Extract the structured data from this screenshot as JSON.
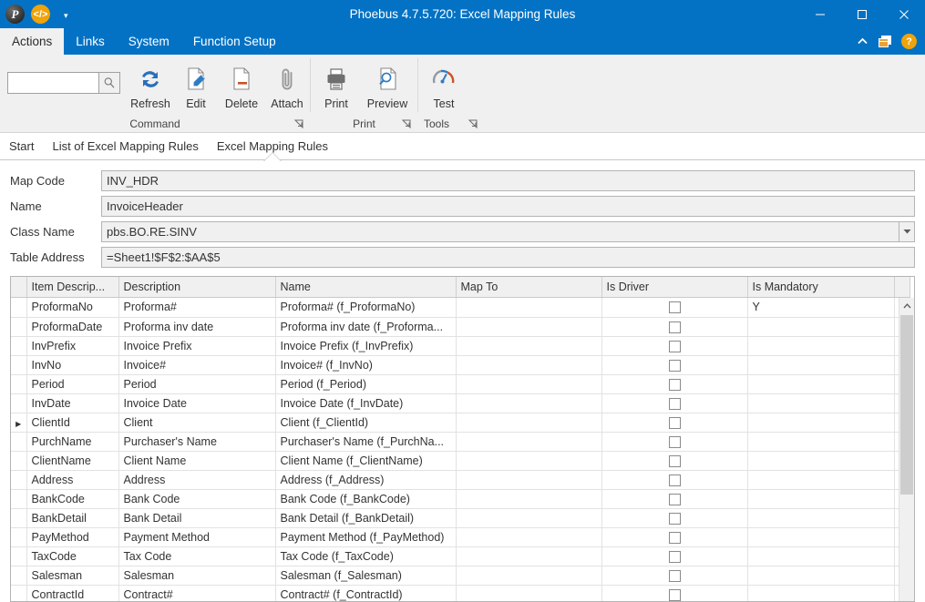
{
  "window": {
    "title": "Phoebus 4.7.5.720: Excel Mapping Rules",
    "quick_access": [
      {
        "name": "phoebus-logo",
        "glyph": "P"
      },
      {
        "name": "code-icon",
        "glyph": "</>"
      }
    ],
    "qat_dropdown_glyph": "▾",
    "controls": {
      "minimize": "─",
      "maximize": "☐",
      "close": "✕"
    },
    "accent_color": "#0472c4",
    "help_glyph": "?",
    "collapse_glyph": "⌃"
  },
  "menu": {
    "tabs": [
      {
        "label": "Actions",
        "active": true
      },
      {
        "label": "Links",
        "active": false
      },
      {
        "label": "System",
        "active": false
      },
      {
        "label": "Function Setup",
        "active": false
      }
    ]
  },
  "ribbon": {
    "search": {
      "value": "",
      "placeholder": ""
    },
    "groups": [
      {
        "label": "Command",
        "has_launcher": true,
        "buttons": [
          {
            "label": "Refresh",
            "icon": "refresh-icon"
          },
          {
            "label": "Edit",
            "icon": "edit-document-icon"
          },
          {
            "label": "Delete",
            "icon": "delete-document-icon"
          },
          {
            "label": "Attach",
            "icon": "paperclip-icon"
          }
        ]
      },
      {
        "label": "Print",
        "has_launcher": true,
        "buttons": [
          {
            "label": "Print",
            "icon": "printer-icon"
          },
          {
            "label": "Preview",
            "icon": "print-preview-icon"
          }
        ]
      },
      {
        "label": "Tools",
        "has_launcher": true,
        "buttons": [
          {
            "label": "Test",
            "icon": "gauge-test-icon"
          }
        ]
      }
    ]
  },
  "form_tabs": [
    {
      "label": "Start",
      "active": false
    },
    {
      "label": "List of Excel Mapping Rules",
      "active": false
    },
    {
      "label": "Excel Mapping Rules",
      "active": true
    }
  ],
  "form": {
    "fields": [
      {
        "label": "Map Code",
        "value": "INV_HDR",
        "type": "text"
      },
      {
        "label": "Name",
        "value": "InvoiceHeader",
        "type": "text"
      },
      {
        "label": "Class Name",
        "value": "pbs.BO.RE.SINV",
        "type": "combo"
      },
      {
        "label": "Table Address",
        "value": "=Sheet1!$F$2:$AA$5",
        "type": "text"
      }
    ]
  },
  "grid": {
    "columns": [
      "Item Descrip...",
      "Description",
      "Name",
      "Map To",
      "Is Driver",
      "Is Mandatory"
    ],
    "selected_row_index": 6,
    "rows": [
      {
        "item": "ProformaNo",
        "description": "Proforma#",
        "name": "Proforma# (f_ProformaNo)",
        "map_to": "",
        "is_driver": false,
        "is_mandatory": "Y"
      },
      {
        "item": "ProformaDate",
        "description": "Proforma inv date",
        "name": "Proforma inv date (f_Proforma...",
        "map_to": "",
        "is_driver": false,
        "is_mandatory": ""
      },
      {
        "item": "InvPrefix",
        "description": "Invoice Prefix",
        "name": "Invoice Prefix (f_InvPrefix)",
        "map_to": "",
        "is_driver": false,
        "is_mandatory": ""
      },
      {
        "item": "InvNo",
        "description": "Invoice#",
        "name": "Invoice# (f_InvNo)",
        "map_to": "",
        "is_driver": false,
        "is_mandatory": ""
      },
      {
        "item": "Period",
        "description": "Period",
        "name": "Period (f_Period)",
        "map_to": "",
        "is_driver": false,
        "is_mandatory": ""
      },
      {
        "item": "InvDate",
        "description": "Invoice Date",
        "name": "Invoice Date (f_InvDate)",
        "map_to": "",
        "is_driver": false,
        "is_mandatory": ""
      },
      {
        "item": "ClientId",
        "description": "Client",
        "name": "Client (f_ClientId)",
        "map_to": "",
        "is_driver": false,
        "is_mandatory": ""
      },
      {
        "item": "PurchName",
        "description": "Purchaser's Name",
        "name": "Purchaser's Name (f_PurchNa...",
        "map_to": "",
        "is_driver": false,
        "is_mandatory": ""
      },
      {
        "item": "ClientName",
        "description": "Client Name",
        "name": "Client Name (f_ClientName)",
        "map_to": "",
        "is_driver": false,
        "is_mandatory": ""
      },
      {
        "item": "Address",
        "description": "Address",
        "name": "Address (f_Address)",
        "map_to": "",
        "is_driver": false,
        "is_mandatory": ""
      },
      {
        "item": "BankCode",
        "description": "Bank Code",
        "name": "Bank Code (f_BankCode)",
        "map_to": "",
        "is_driver": false,
        "is_mandatory": ""
      },
      {
        "item": "BankDetail",
        "description": "Bank Detail",
        "name": "Bank Detail (f_BankDetail)",
        "map_to": "",
        "is_driver": false,
        "is_mandatory": ""
      },
      {
        "item": "PayMethod",
        "description": "Payment Method",
        "name": "Payment Method (f_PayMethod)",
        "map_to": "",
        "is_driver": false,
        "is_mandatory": ""
      },
      {
        "item": "TaxCode",
        "description": "Tax Code",
        "name": "Tax Code (f_TaxCode)",
        "map_to": "",
        "is_driver": false,
        "is_mandatory": ""
      },
      {
        "item": "Salesman",
        "description": "Salesman",
        "name": "Salesman (f_Salesman)",
        "map_to": "",
        "is_driver": false,
        "is_mandatory": ""
      },
      {
        "item": "ContractId",
        "description": "Contract#",
        "name": "Contract# (f_ContractId)",
        "map_to": "",
        "is_driver": false,
        "is_mandatory": ""
      }
    ],
    "scroll_up_glyph": "⌃"
  }
}
